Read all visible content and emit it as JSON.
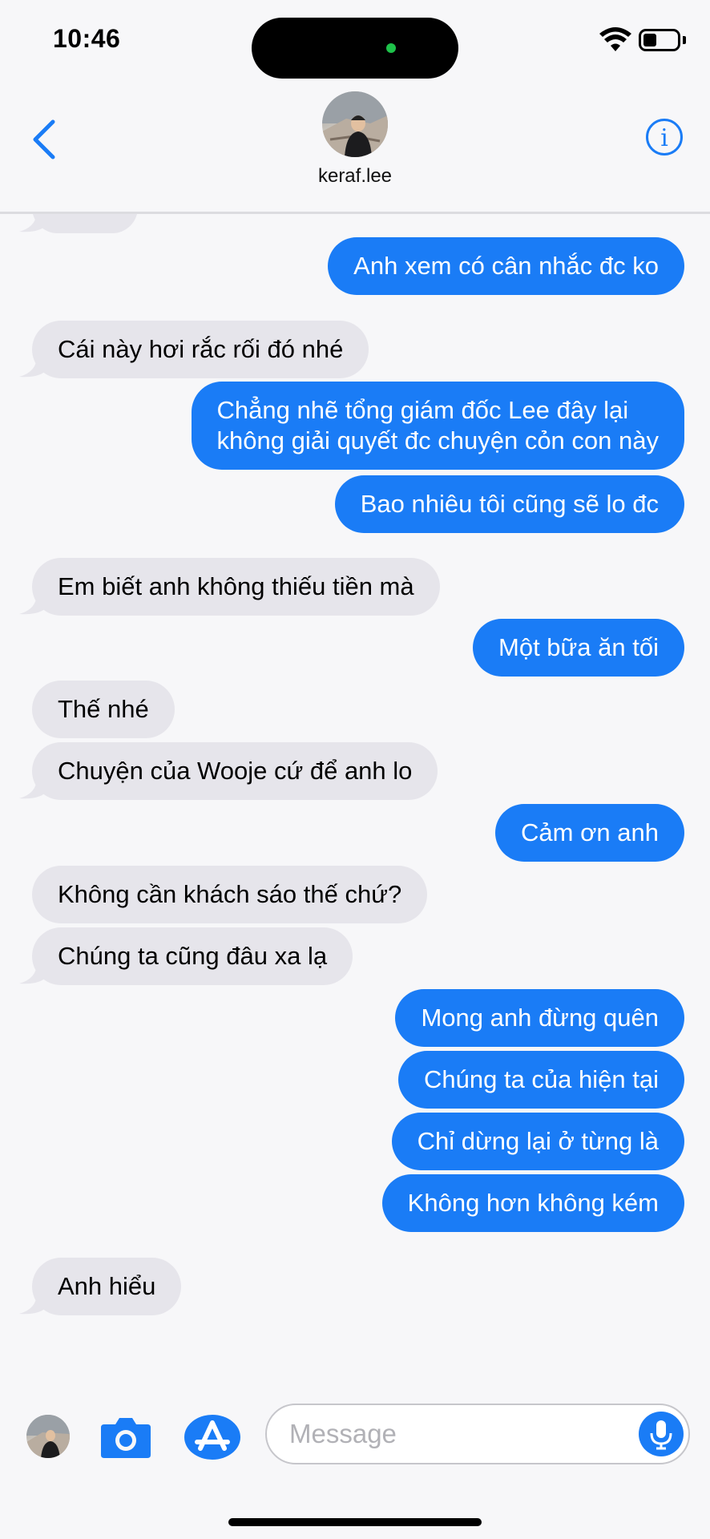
{
  "status_bar": {
    "time": "10:46"
  },
  "header": {
    "contact_name": "keraf.lee"
  },
  "messages": [
    {
      "dir": "out",
      "text": "Anh xem có cân nhắc đc ko"
    },
    {
      "dir": "in",
      "text": "Cái này hơi rắc rối đó nhé"
    },
    {
      "dir": "out",
      "text": "Chẳng nhẽ tổng giám đốc Lee đây lại\nkhông giải quyết đc chuyện cỏn con này"
    },
    {
      "dir": "out",
      "text": "Bao nhiêu tôi cũng sẽ lo đc"
    },
    {
      "dir": "in",
      "text": "Em biết anh không thiếu tiền mà"
    },
    {
      "dir": "out",
      "text": "Một bữa ăn tối"
    },
    {
      "dir": "in",
      "text": "Thế nhé"
    },
    {
      "dir": "in",
      "text": "Chuyện của Wooje cứ để anh lo"
    },
    {
      "dir": "out",
      "text": "Cảm ơn anh"
    },
    {
      "dir": "in",
      "text": "Không cần khách sáo thế chứ?"
    },
    {
      "dir": "in",
      "text": "Chúng ta cũng đâu xa lạ"
    },
    {
      "dir": "out",
      "text": "Mong anh đừng quên"
    },
    {
      "dir": "out",
      "text": "Chúng ta của hiện tại"
    },
    {
      "dir": "out",
      "text": "Chỉ dừng lại ở từng là"
    },
    {
      "dir": "out",
      "text": "Không hơn không kém"
    },
    {
      "dir": "in",
      "text": "Anh hiểu"
    }
  ],
  "composer": {
    "placeholder": "Message"
  },
  "colors": {
    "accent": "#1a7cf6",
    "incoming_bubble": "#e6e5eb",
    "background": "#f7f7f9"
  }
}
